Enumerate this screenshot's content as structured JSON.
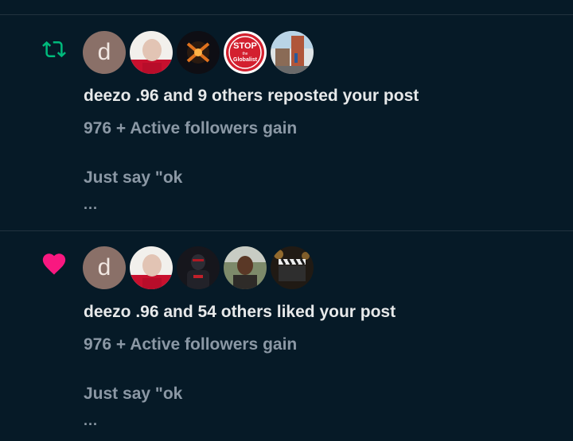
{
  "notifications": [
    {
      "type_icon": "repost-icon",
      "type_color": "#00ba7c",
      "avatars": [
        {
          "letter": "d",
          "icon": "avatar-letter-d"
        },
        {
          "icon": "avatar-man-photo"
        },
        {
          "icon": "avatar-dark-logo"
        },
        {
          "icon": "avatar-stop-globalist-sign",
          "text_top": "STOP",
          "text_mid": "the",
          "text_bottom": "Globalist"
        },
        {
          "icon": "avatar-street-photo"
        }
      ],
      "headline": "deezo .96 and 9 others reposted your post",
      "subtext": "976 + Active followers gain",
      "snippet": "Just say \"ok",
      "ellipsis": "..."
    },
    {
      "type_icon": "heart-icon",
      "type_color": "#f91880",
      "avatars": [
        {
          "letter": "d",
          "icon": "avatar-letter-d"
        },
        {
          "icon": "avatar-man-photo"
        },
        {
          "icon": "avatar-dark-figure"
        },
        {
          "icon": "avatar-man-outdoor"
        },
        {
          "icon": "avatar-clapperboard"
        }
      ],
      "headline": "deezo .96 and 54 others liked your post",
      "subtext": "976 + Active followers gain",
      "snippet": "Just say \"ok",
      "ellipsis": "..."
    }
  ]
}
